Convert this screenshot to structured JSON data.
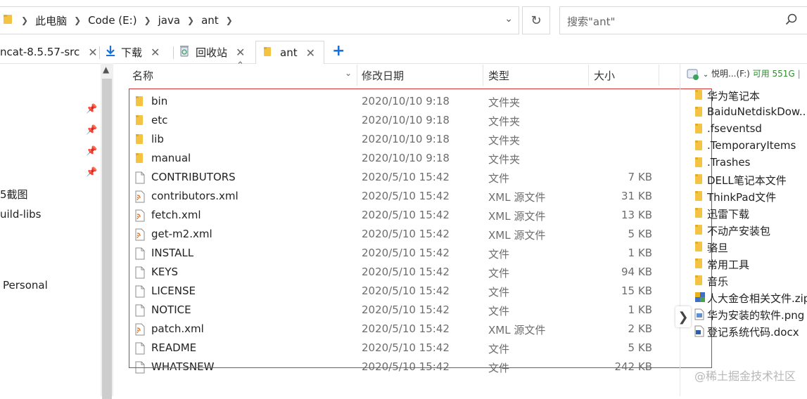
{
  "address": {
    "crumbs": [
      "此电脑",
      "Code (E:)",
      "java",
      "ant"
    ]
  },
  "search": {
    "placeholder": "搜索\"ant\""
  },
  "tabs": [
    {
      "label": "ncat-8.5.57-src"
    },
    {
      "label": "下载"
    },
    {
      "label": "回收站"
    },
    {
      "label": "ant"
    }
  ],
  "left_nav": {
    "items": [
      "5截图",
      "uild-libs",
      "Personal"
    ]
  },
  "columns": {
    "name": "名称",
    "date": "修改日期",
    "type": "类型",
    "size": "大小"
  },
  "files": [
    {
      "name": "bin",
      "date": "2020/10/10 9:18",
      "type": "文件夹",
      "size": "",
      "icon": "folder"
    },
    {
      "name": "etc",
      "date": "2020/10/10 9:18",
      "type": "文件夹",
      "size": "",
      "icon": "folder"
    },
    {
      "name": "lib",
      "date": "2020/10/10 9:18",
      "type": "文件夹",
      "size": "",
      "icon": "folder"
    },
    {
      "name": "manual",
      "date": "2020/10/10 9:18",
      "type": "文件夹",
      "size": "",
      "icon": "folder"
    },
    {
      "name": "CONTRIBUTORS",
      "date": "2020/5/10 15:42",
      "type": "文件",
      "size": "7 KB",
      "icon": "file"
    },
    {
      "name": "contributors.xml",
      "date": "2020/5/10 15:42",
      "type": "XML 源文件",
      "size": "31 KB",
      "icon": "xml"
    },
    {
      "name": "fetch.xml",
      "date": "2020/5/10 15:42",
      "type": "XML 源文件",
      "size": "13 KB",
      "icon": "xml"
    },
    {
      "name": "get-m2.xml",
      "date": "2020/5/10 15:42",
      "type": "XML 源文件",
      "size": "5 KB",
      "icon": "xml"
    },
    {
      "name": "INSTALL",
      "date": "2020/5/10 15:42",
      "type": "文件",
      "size": "1 KB",
      "icon": "file"
    },
    {
      "name": "KEYS",
      "date": "2020/5/10 15:42",
      "type": "文件",
      "size": "94 KB",
      "icon": "file"
    },
    {
      "name": "LICENSE",
      "date": "2020/5/10 15:42",
      "type": "文件",
      "size": "15 KB",
      "icon": "file"
    },
    {
      "name": "NOTICE",
      "date": "2020/5/10 15:42",
      "type": "文件",
      "size": "1 KB",
      "icon": "file"
    },
    {
      "name": "patch.xml",
      "date": "2020/5/10 15:42",
      "type": "XML 源文件",
      "size": "2 KB",
      "icon": "xml"
    },
    {
      "name": "README",
      "date": "2020/5/10 15:42",
      "type": "文件",
      "size": "5 KB",
      "icon": "file"
    },
    {
      "name": "WHATSNEW",
      "date": "2020/5/10 15:42",
      "type": "文件",
      "size": "242 KB",
      "icon": "file"
    }
  ],
  "right_panel": {
    "drive_label": "悦明...(F:)",
    "drive_free": "可用 551G",
    "items": [
      {
        "name": "华为笔记本",
        "icon": "folder"
      },
      {
        "name": "BaiduNetdiskDow...",
        "icon": "folder"
      },
      {
        "name": ".fseventsd",
        "icon": "folder"
      },
      {
        "name": ".TemporaryItems",
        "icon": "folder"
      },
      {
        "name": ".Trashes",
        "icon": "folder"
      },
      {
        "name": "DELL笔记本文件",
        "icon": "folder"
      },
      {
        "name": "ThinkPad文件",
        "icon": "folder"
      },
      {
        "name": "迅雷下载",
        "icon": "folder"
      },
      {
        "name": "不动产安装包",
        "icon": "folder"
      },
      {
        "name": "骆旦",
        "icon": "folder"
      },
      {
        "name": "常用工具",
        "icon": "folder"
      },
      {
        "name": "音乐",
        "icon": "folder"
      },
      {
        "name": "人大金仓相关文件.zip",
        "icon": "zip"
      },
      {
        "name": "华为安装的软件.png",
        "icon": "image"
      },
      {
        "name": "登记系统代码.docx",
        "icon": "docx"
      }
    ]
  },
  "watermark": "@稀土掘金技术社区",
  "colors": {
    "folder": "#f5c342",
    "xml": "#e07a2f",
    "accent": "#1a6fd8",
    "annotation": "#d23333"
  }
}
